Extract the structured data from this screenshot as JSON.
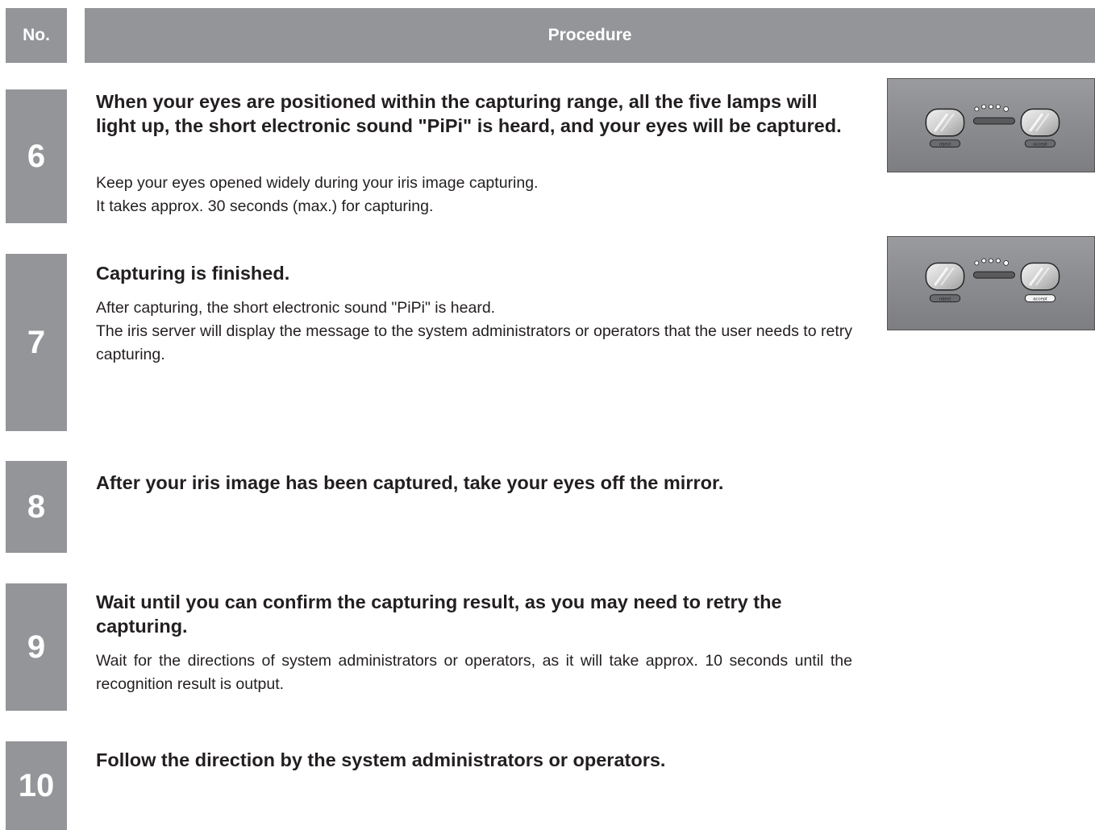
{
  "header": {
    "no": "No.",
    "procedure": "Procedure"
  },
  "steps": [
    {
      "no": "6",
      "title": "When your eyes are positioned within the capturing range, all the five lamps will light up, the short electronic sound \"PiPi\" is heard, and your eyes will be captured.",
      "body": [
        "Keep your eyes opened widely during your iris image capturing.",
        "It takes approx. 30 seconds (max.) for capturing."
      ],
      "panel": {
        "reject_label": "reject",
        "accept_label": "accept",
        "highlighted": "none"
      }
    },
    {
      "no": "7",
      "title": "Capturing is finished.",
      "body": [
        "After capturing, the short electronic sound \"PiPi\" is heard.",
        "The iris server will display the message to the system administrators or operators that the user needs to retry capturing."
      ],
      "panel": {
        "reject_label": "reject",
        "accept_label": "accept",
        "highlighted": "accept"
      }
    },
    {
      "no": "8",
      "title": "After your iris image has been captured, take your eyes off the mirror.",
      "body": []
    },
    {
      "no": "9",
      "title": "Wait until you can confirm the capturing result, as you may need to retry the capturing.",
      "body": [
        "Wait for the directions of system administrators or operators, as it will take approx. 10 seconds until the recognition result is output."
      ]
    },
    {
      "no": "10",
      "title": "Follow the direction by the system administrators or operators.",
      "body": []
    }
  ]
}
